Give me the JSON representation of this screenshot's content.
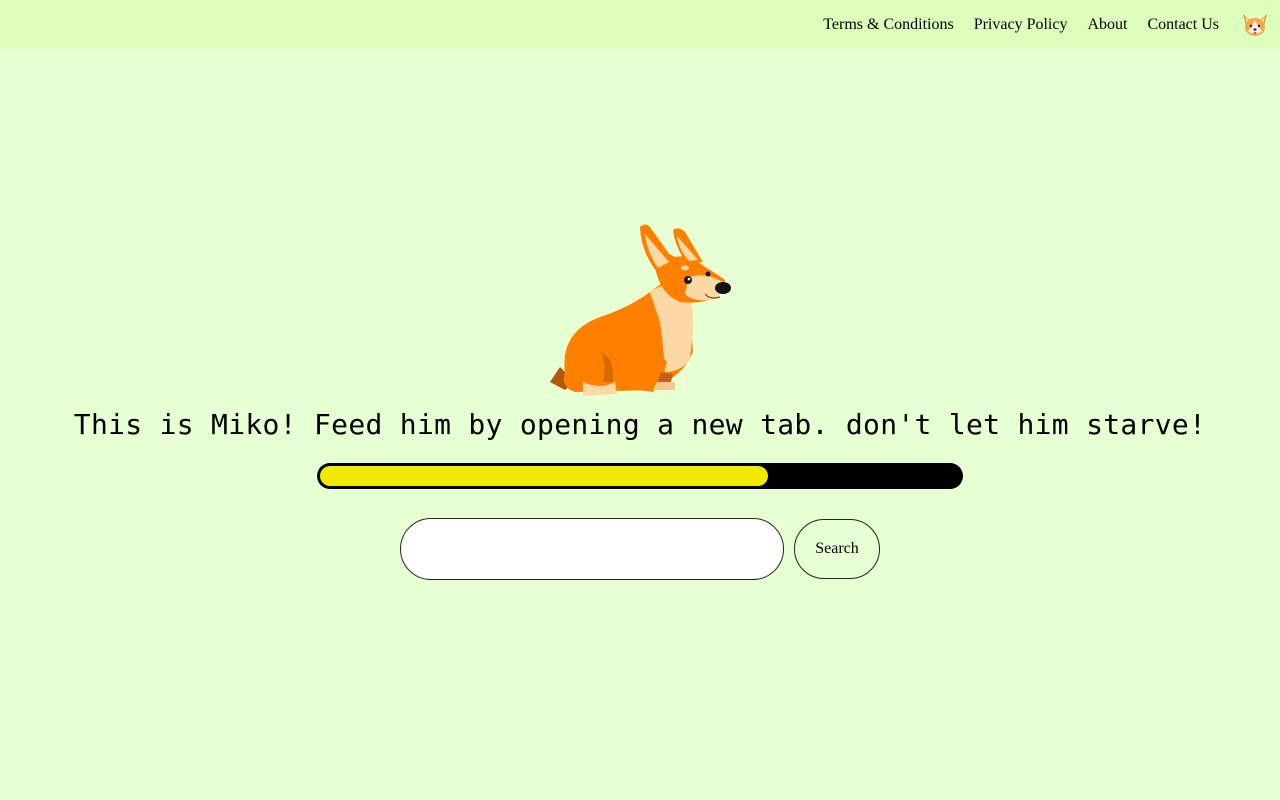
{
  "nav": {
    "links": [
      {
        "label": "Terms & Conditions"
      },
      {
        "label": "Privacy Policy"
      },
      {
        "label": "About"
      },
      {
        "label": "Contact Us"
      }
    ],
    "logo_icon": "corgi-face-icon"
  },
  "main": {
    "mascot": "corgi-illustration",
    "message": "This is Miko! Feed him by opening a new tab. don't let him starve!",
    "hunger_bar": {
      "percent": 70,
      "fill_color": "#f1ea00",
      "track_color": "#000000"
    },
    "search": {
      "value": "",
      "placeholder": "",
      "button_label": "Search"
    }
  },
  "colors": {
    "header_bg": "#deffbb",
    "page_bg": "#e6ffd3",
    "corgi_orange": "#ff8000",
    "corgi_cream": "#fcd9a4"
  }
}
